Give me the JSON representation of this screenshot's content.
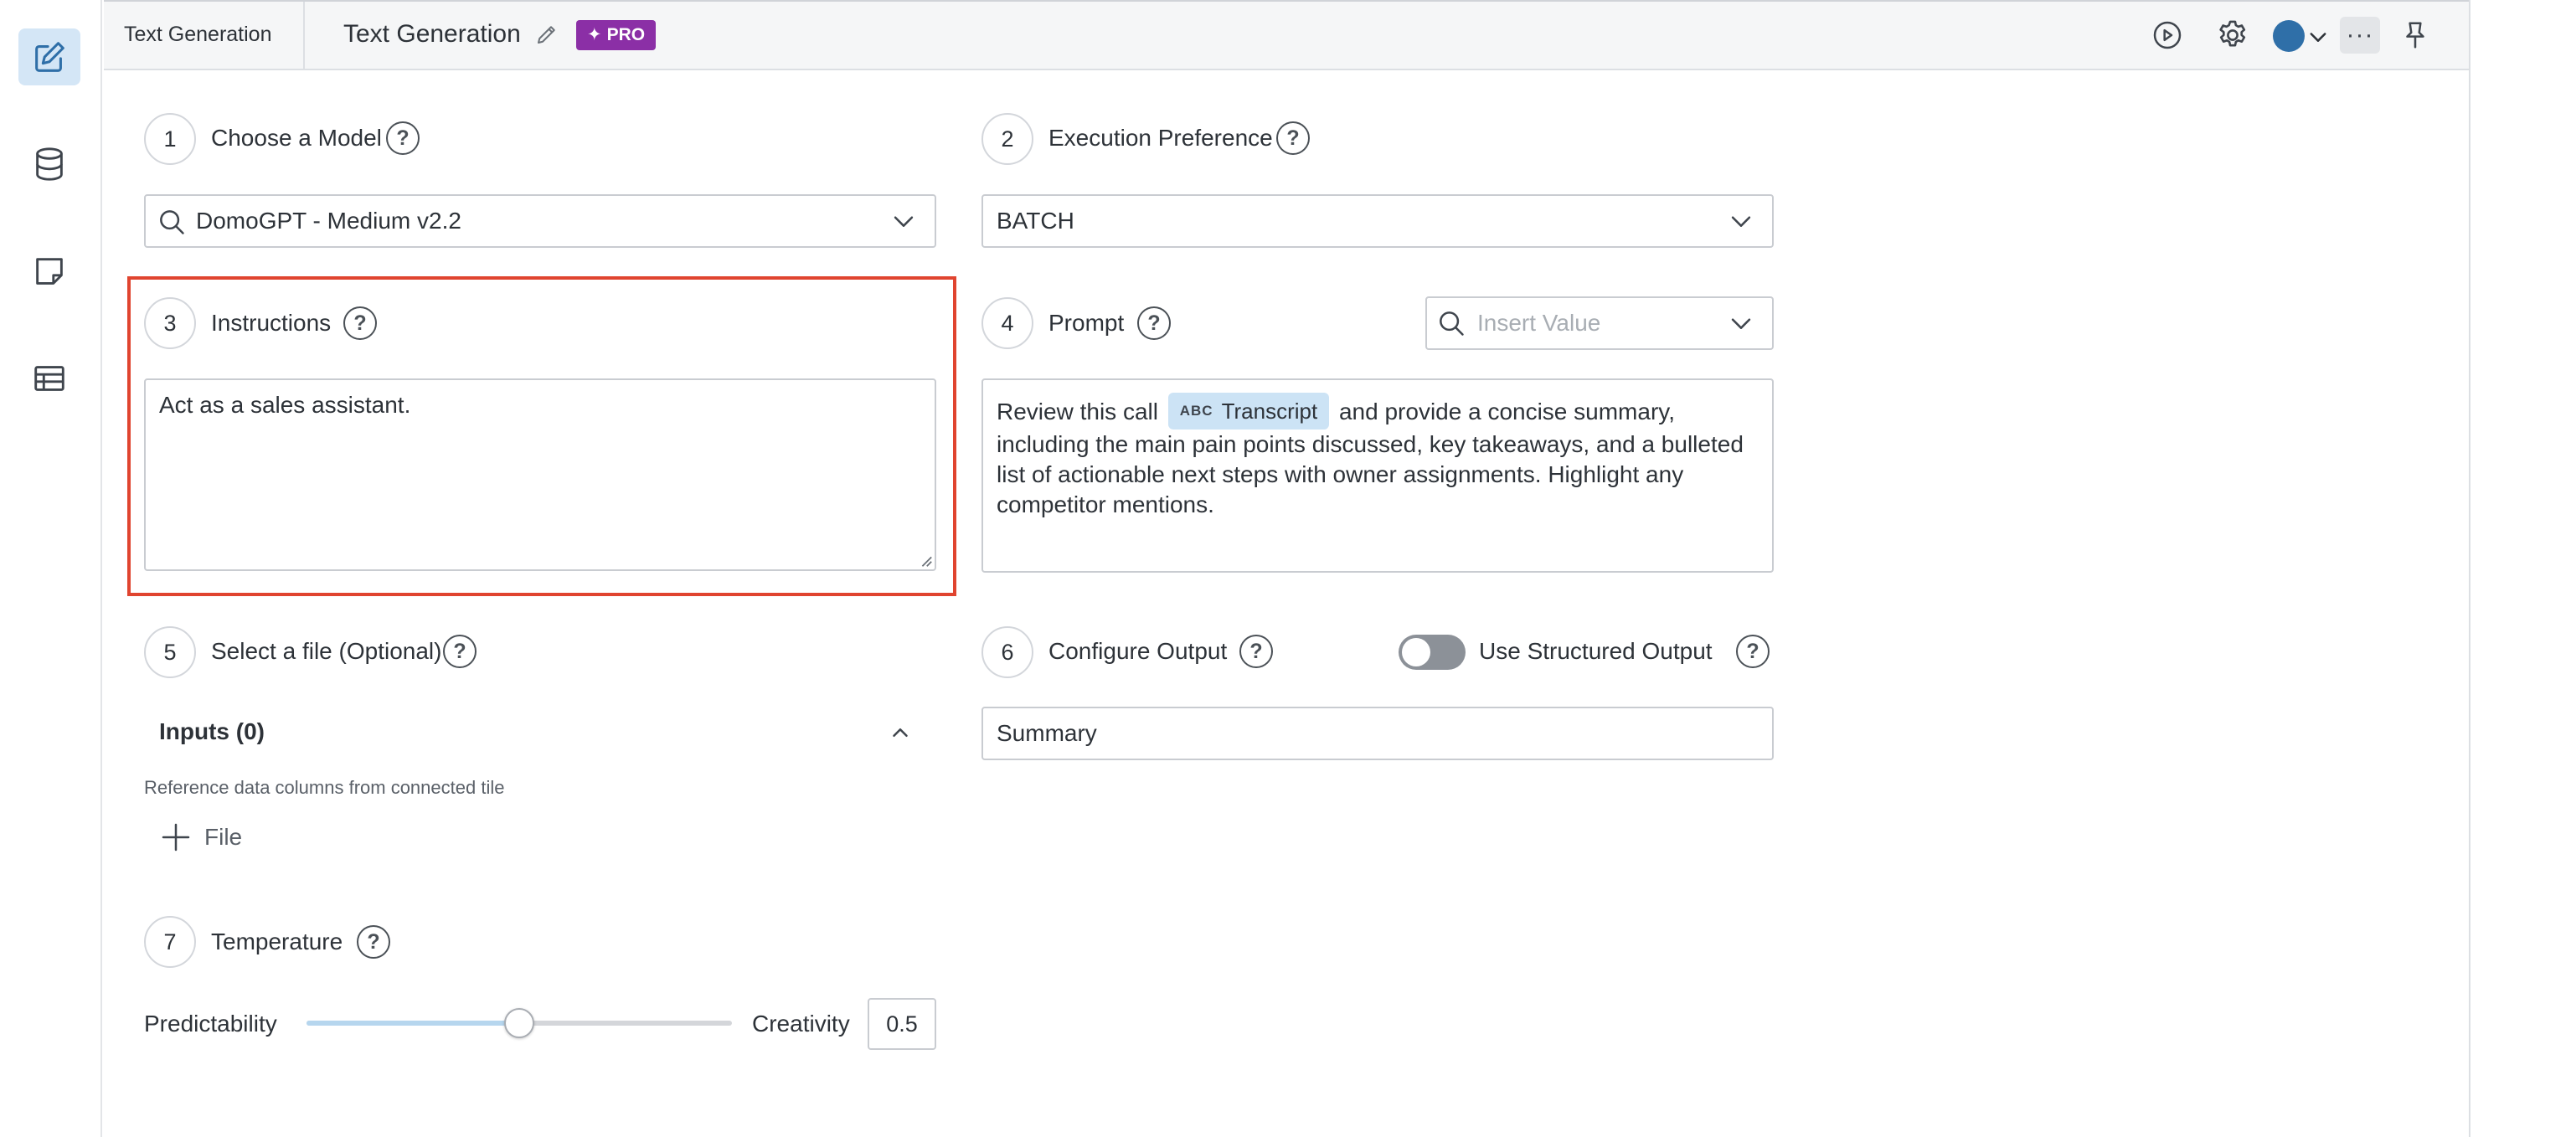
{
  "app": {
    "tab_name": "Text Generation",
    "title": "Text Generation",
    "pro_badge": "PRO"
  },
  "sidebar": {
    "items": [
      {
        "icon": "edit-icon",
        "active": true
      },
      {
        "icon": "database-icon",
        "active": false
      },
      {
        "icon": "note-icon",
        "active": false
      },
      {
        "icon": "table-icon",
        "active": false
      }
    ]
  },
  "toolbar": {
    "icons": [
      "play-icon",
      "gear-icon",
      "avatar",
      "chevron-down-icon",
      "more-icon",
      "pin-icon"
    ],
    "more_label": "···"
  },
  "steps": {
    "model": {
      "num": "1",
      "label": "Choose a Model",
      "value": "DomoGPT - Medium v2.2"
    },
    "execution": {
      "num": "2",
      "label": "Execution Preference",
      "value": "BATCH"
    },
    "instructions": {
      "num": "3",
      "label": "Instructions",
      "value": "Act as a sales assistant."
    },
    "prompt": {
      "num": "4",
      "label": "Prompt",
      "insert_placeholder": "Insert Value",
      "text_before": "Review this call",
      "chip_type": "ABC",
      "chip_label": "Transcript",
      "text_after": "and provide a concise summary, including the main pain points discussed, key takeaways, and a bulleted list of actionable next steps with owner assignments. Highlight any competitor mentions."
    },
    "file": {
      "num": "5",
      "label": "Select a file (Optional)",
      "inputs_title": "Inputs (0)",
      "inputs_description": "Reference data columns from connected tile",
      "add_file_label": "File"
    },
    "output": {
      "num": "6",
      "label": "Configure Output",
      "structured_label": "Use Structured Output",
      "structured_enabled": false,
      "value": "Summary"
    },
    "temperature": {
      "num": "7",
      "label": "Temperature",
      "min_label": "Predictability",
      "max_label": "Creativity",
      "value": "0.5",
      "level": 0.5
    }
  },
  "colors": {
    "accent": "#8b2fa6",
    "highlight": "#e0442f",
    "chip": "#cce3f5"
  }
}
